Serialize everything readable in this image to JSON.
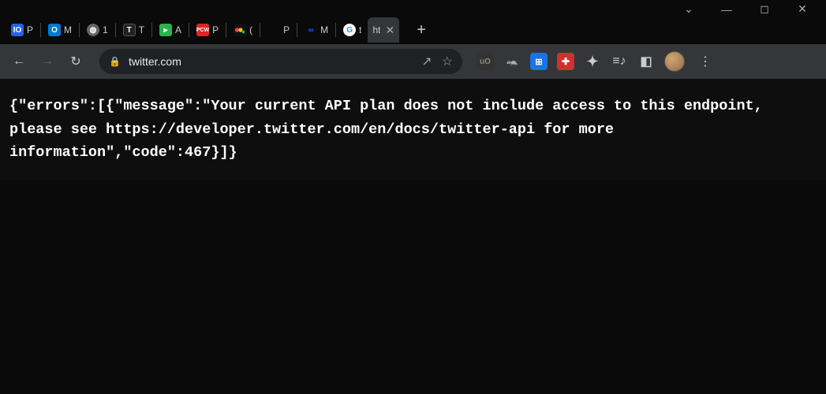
{
  "window_controls": {
    "dropdown": "⌄",
    "minimize": "—",
    "maximize": "◻",
    "close": "✕"
  },
  "tabs": [
    {
      "icon_cls": "blue-io",
      "icon_text": "IO",
      "title": "P"
    },
    {
      "icon_cls": "outlook",
      "icon_text": "O",
      "title": "M"
    },
    {
      "icon_cls": "globe",
      "icon_text": "◍",
      "title": "1"
    },
    {
      "icon_cls": "t-icon",
      "icon_text": "T",
      "title": "T"
    },
    {
      "icon_cls": "feedly",
      "icon_text": "▸",
      "title": "A"
    },
    {
      "icon_cls": "pcw",
      "icon_text": "PCW",
      "title": "P"
    },
    {
      "icon_cls": "monday",
      "icon_text": "",
      "title": "("
    },
    {
      "icon_cls": "blank",
      "icon_text": "",
      "title": "P"
    },
    {
      "icon_cls": "meta",
      "icon_text": "∞",
      "title": "M"
    },
    {
      "icon_cls": "google",
      "icon_text": "G",
      "title": "t"
    }
  ],
  "active_tab": {
    "title": "ht",
    "close": "✕"
  },
  "new_tab": "+",
  "toolbar": {
    "back": "←",
    "forward": "→",
    "reload": "↻"
  },
  "url_bar": {
    "lock": "🔒",
    "url": "twitter.com",
    "share": "↗",
    "bookmark": "☆"
  },
  "extensions": {
    "ublock": "uO",
    "badger": "🦡",
    "blue": "⊞",
    "shield": "✚",
    "puzzle": "✦",
    "music": "≡♪",
    "panel": "◧"
  },
  "menu": "⋮",
  "page_body": "{\"errors\":[{\"message\":\"Your current API plan does not include access to this endpoint, please see https://developer.twitter.com/en/docs/twitter-api for more information\",\"code\":467}]}"
}
